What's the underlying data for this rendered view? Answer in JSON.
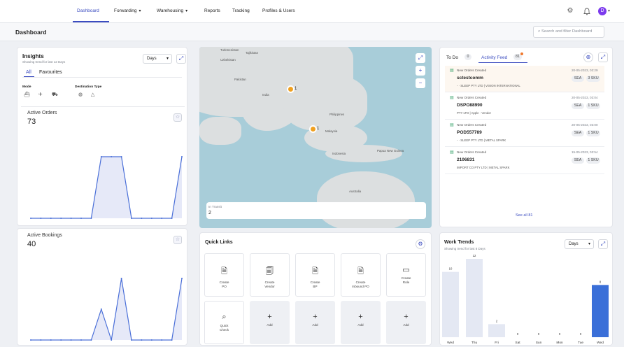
{
  "nav": {
    "items": [
      {
        "label": "Dashboard",
        "dropdown": false,
        "active": true
      },
      {
        "label": "Forwarding",
        "dropdown": true,
        "active": false
      },
      {
        "label": "Warehousing",
        "dropdown": true,
        "active": false
      },
      {
        "label": "Reports",
        "dropdown": false,
        "active": false
      },
      {
        "label": "Tracking",
        "dropdown": false,
        "active": false
      },
      {
        "label": "Profiles & Users",
        "dropdown": false,
        "active": false
      }
    ],
    "avatar_initial": "D",
    "accent": "#3b4cc0",
    "avatar_color": "#7c3aed"
  },
  "page": {
    "title": "Dashboard",
    "search_placeholder": "Search and filter Dashboard"
  },
  "insights": {
    "title": "Insights",
    "subtitle": "Showing trend for last 12 Days",
    "range": "Days",
    "tabs": [
      "All",
      "Favourites"
    ],
    "mode_label": "Mode",
    "destination_label": "Destination Type",
    "mode_icons": [
      "ship-icon",
      "plane-icon",
      "truck-icon"
    ],
    "destination_icons": [
      "globe-icon",
      "triangle-icon"
    ]
  },
  "active_orders": {
    "title": "Active Orders",
    "value": "73",
    "series": [
      0,
      0,
      0,
      0,
      0,
      0,
      0,
      5,
      5,
      5,
      0,
      0,
      0,
      0,
      0,
      5
    ]
  },
  "active_bookings": {
    "title": "Active Bookings",
    "value": "40",
    "series": [
      0,
      0,
      0,
      0,
      0,
      0,
      0,
      2,
      0,
      4,
      0,
      0,
      0,
      0,
      0,
      4
    ]
  },
  "map": {
    "labels": [
      {
        "text": "Turkmenistan"
      },
      {
        "text": "Tajikistan"
      },
      {
        "text": "Uzbekistan"
      },
      {
        "text": "Pakistan"
      },
      {
        "text": "India"
      },
      {
        "text": "Philippines"
      },
      {
        "text": "Malaysia"
      },
      {
        "text": "Indonesia"
      },
      {
        "text": "Papua New Guinea"
      },
      {
        "text": "Australia"
      }
    ],
    "pins": [
      {
        "count": "1"
      },
      {
        "count": "1"
      }
    ],
    "in_transit_label": "In Transit",
    "in_transit_value": "2"
  },
  "todo": {
    "tab_todo": "To Do",
    "todo_count": "0",
    "tab_feed": "Activity Feed",
    "feed_count": "81",
    "see_all": "See all 81",
    "items": [
      {
        "type": "New Orders Created",
        "date": "20-05-2023, 03:29",
        "id": "sctestcomm",
        "parties": "- · SLEEP PTY LTD | VISION INTERNATIONAL",
        "mode": "SEA",
        "sku": "3 SKU"
      },
      {
        "type": "New Orders Created",
        "date": "20-05-2023, 03:04",
        "id": "DSPO88990",
        "parties": "PTY LTD | Apple · Vendor",
        "mode": "SEA",
        "sku": "1 SKU"
      },
      {
        "type": "New Orders Created",
        "date": "20-05-2023, 03:00",
        "id": "POD557789",
        "parties": "- · SLEEP PTY LTD | METAL SPARK",
        "mode": "SEA",
        "sku": "1 SKU"
      },
      {
        "type": "New Orders Created",
        "date": "15-05-2023, 03:54",
        "id": "2106831",
        "parties": "IMPORT CO PTY LTD | METAL SPARK",
        "mode": "SEA",
        "sku": "1 SKU"
      }
    ]
  },
  "quick_links": {
    "title": "Quick Links",
    "tiles": [
      {
        "label": "Create\nPO",
        "icon": "document-icon",
        "filled": true
      },
      {
        "label": "Create\nVendor",
        "icon": "vendor-icon",
        "filled": true
      },
      {
        "label": "Create\nBP",
        "icon": "document-icon",
        "filled": true
      },
      {
        "label": "Create\nInbound PO",
        "icon": "document-icon",
        "filled": true
      },
      {
        "label": "Create\nRole",
        "icon": "role-icon",
        "filled": true
      },
      {
        "label": "Quick\nCheck",
        "icon": "search-icon",
        "filled": true
      },
      {
        "label": "Add",
        "icon": "plus-icon",
        "filled": false
      },
      {
        "label": "Add",
        "icon": "plus-icon",
        "filled": false
      },
      {
        "label": "Add",
        "icon": "plus-icon",
        "filled": false
      },
      {
        "label": "Add",
        "icon": "plus-icon",
        "filled": false
      }
    ]
  },
  "work_trends": {
    "title": "Work Trends",
    "subtitle": "Showing trend for last 8 Days",
    "range": "Days"
  },
  "chart_data": {
    "type": "bar",
    "categories": [
      "Wed",
      "Thu",
      "Fri",
      "Sat",
      "Sun",
      "Mon",
      "Tue",
      "Wed"
    ],
    "values": [
      10,
      12,
      2,
      0,
      0,
      0,
      0,
      8
    ],
    "colors": [
      "#e4e8f3",
      "#e4e8f3",
      "#e4e8f3",
      "#e4e8f3",
      "#e4e8f3",
      "#e4e8f3",
      "#e4e8f3",
      "#3a6fd8"
    ],
    "ylim": [
      0,
      12
    ]
  }
}
